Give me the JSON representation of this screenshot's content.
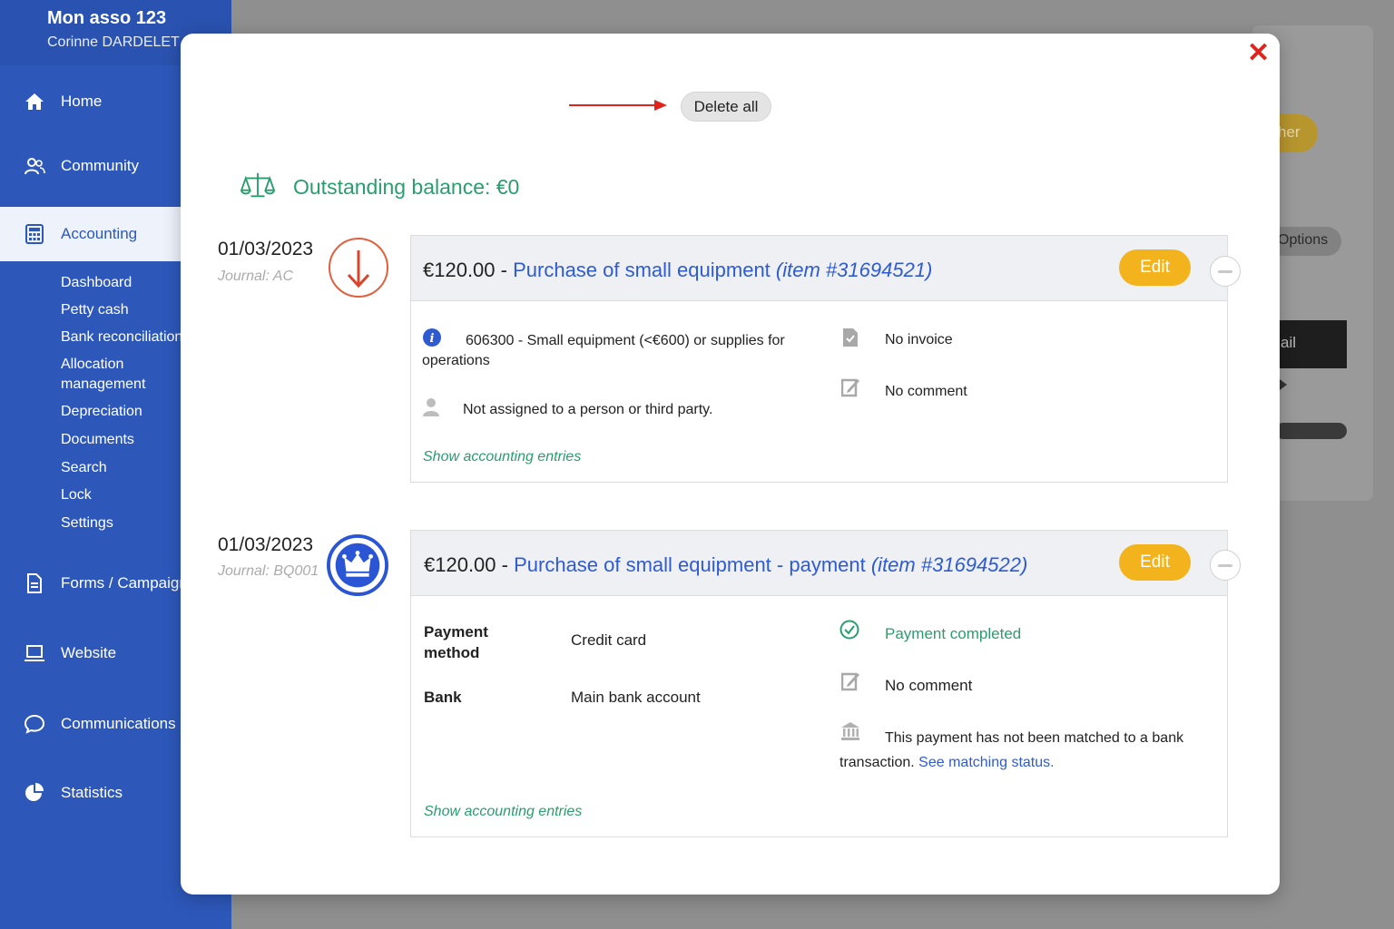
{
  "sidebar": {
    "org_name": "Mon asso 123",
    "user_name": "Corinne DARDELET",
    "nav": {
      "home": "Home",
      "community": "Community",
      "accounting": "Accounting",
      "forms": "Forms / Campaigns",
      "website": "Website",
      "communications": "Communications",
      "statistics": "Statistics"
    },
    "accounting_sub": [
      "Dashboard",
      "Petty cash",
      "Bank reconciliation",
      "Allocation management",
      "Depreciation",
      "Documents",
      "Search",
      "Lock",
      "Settings"
    ]
  },
  "background": {
    "yellow_pill": "her",
    "options": "Options",
    "dark_button": "ail"
  },
  "modal": {
    "delete_all": "Delete all",
    "balance": "Outstanding balance: €0",
    "transactions": [
      {
        "date": "01/03/2023",
        "journal": "Journal: AC",
        "amount": "€120.00",
        "separator": " - ",
        "title": "Purchase of small equipment",
        "item": "(item #31694521)",
        "edit_label": "Edit",
        "account": "606300 - Small equipment (<€600) or supplies for operations",
        "assignment": "Not assigned to a person or third party.",
        "invoice": "No invoice",
        "comment": "No comment",
        "show_entries": "Show accounting entries"
      },
      {
        "date": "01/03/2023",
        "journal": "Journal: BQ001",
        "amount": "€120.00",
        "separator": " - ",
        "title": "Purchase of small equipment - payment",
        "item": "(item #31694522)",
        "edit_label": "Edit",
        "payment_method_label": "Payment method",
        "payment_method_value": "Credit card",
        "bank_label": "Bank",
        "bank_value": "Main bank account",
        "status": "Payment completed",
        "comment": "No comment",
        "matching_text": "This payment has not been matched to a bank transaction.",
        "matching_link": "See matching status.",
        "show_entries": "Show accounting entries"
      }
    ]
  },
  "colors": {
    "sidebar": "#2d58ba",
    "accent_green": "#2a9d6e",
    "edit_yellow": "#f2b31c",
    "link_blue": "#2f5bd0",
    "close_red": "#e0241b"
  }
}
